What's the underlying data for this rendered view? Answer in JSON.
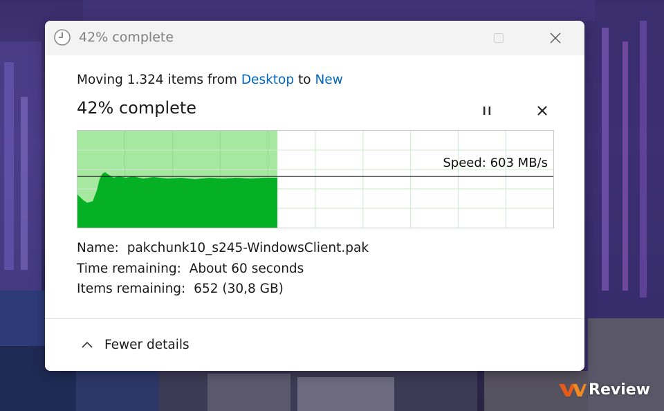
{
  "window": {
    "title": "42% complete",
    "icon": "clock-icon"
  },
  "dialog": {
    "moving_prefix": "Moving 1.324 items from ",
    "source_link": "Desktop",
    "to_word": " to ",
    "dest_link": "New",
    "percent_text": "42% complete",
    "speed_text": "Speed: 603 MB/s",
    "progress_fraction": 0.42,
    "name_label": "Name:",
    "name_value": "pakchunk10_s245-WindowsClient.pak",
    "time_label": "Time remaining:",
    "time_value": "About 60 seconds",
    "items_label": "Items remaining:",
    "items_value": "652 (30,8 GB)",
    "fewer_details": "Fewer details"
  },
  "colors": {
    "accent_link": "#0067c0",
    "graph_fill": "#06b025",
    "graph_fill_light": "#a7e8a0",
    "grid": "#cde8d0"
  },
  "watermark": {
    "text": "Review"
  }
}
